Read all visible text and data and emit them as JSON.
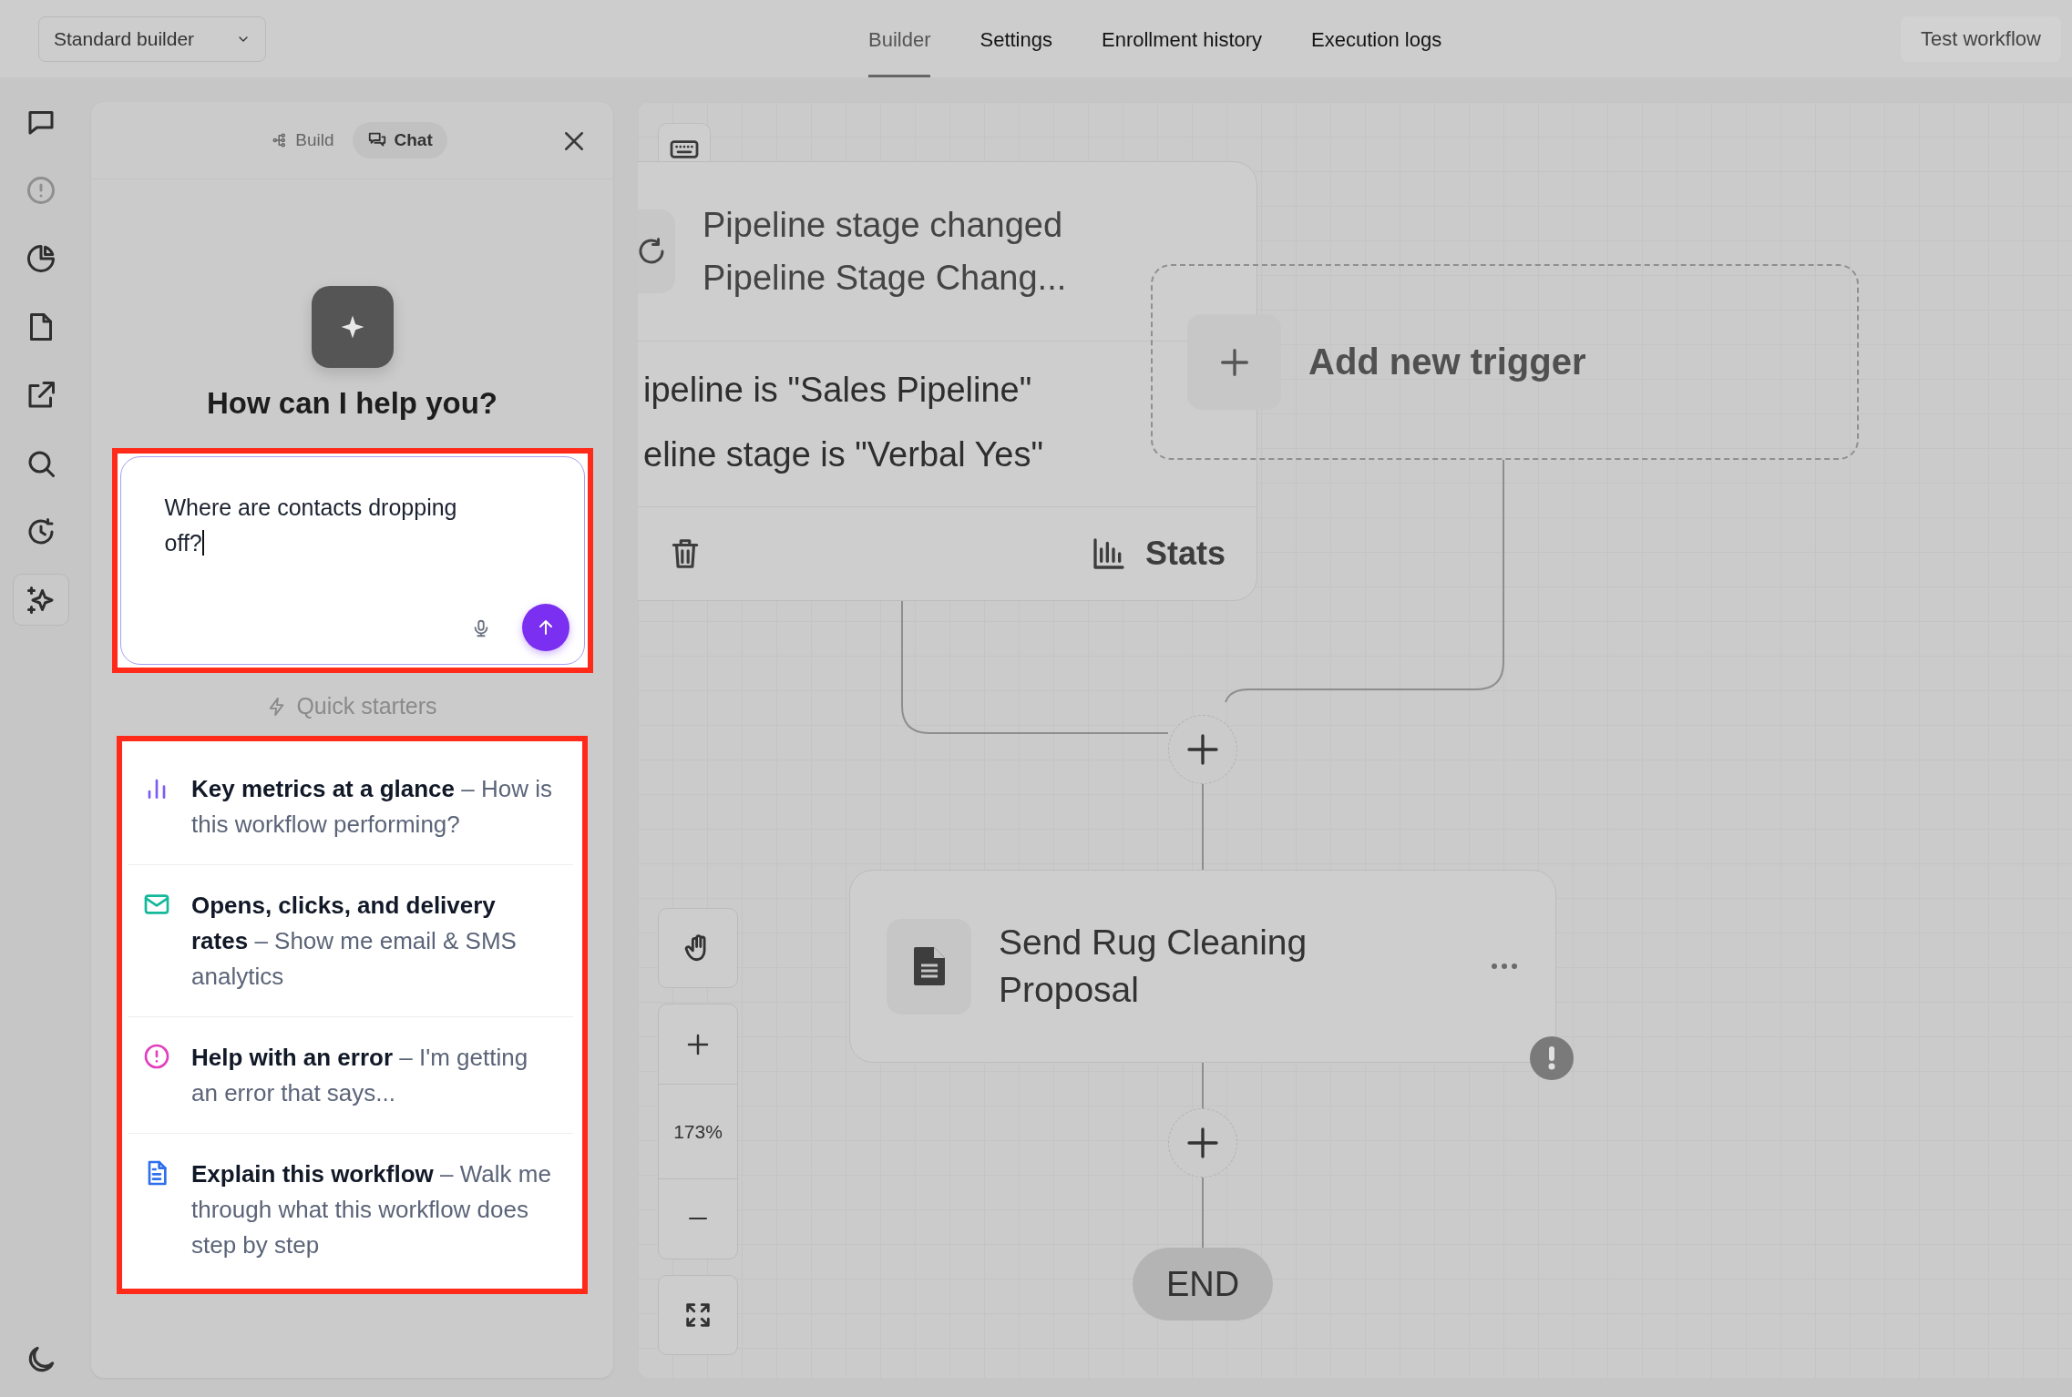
{
  "top_bar": {
    "builder_select": {
      "value": "Standard builder"
    },
    "tabs": [
      {
        "label": "Builder",
        "selected": true
      },
      {
        "label": "Settings",
        "selected": false
      },
      {
        "label": "Enrollment history",
        "selected": false
      },
      {
        "label": "Execution logs",
        "selected": false
      }
    ],
    "test_button": "Test workflow"
  },
  "sidebar": {
    "items": [
      {
        "selected": false,
        "disabled": false
      },
      {
        "selected": false,
        "disabled": true
      },
      {
        "selected": false,
        "disabled": false
      },
      {
        "selected": false,
        "disabled": false
      },
      {
        "selected": false,
        "disabled": false
      },
      {
        "selected": false,
        "disabled": false
      },
      {
        "selected": false,
        "disabled": false
      },
      {
        "selected": true,
        "disabled": false
      }
    ]
  },
  "chat_panel": {
    "mode_tabs": [
      {
        "label": "Build",
        "selected": false
      },
      {
        "label": "Chat",
        "selected": true
      }
    ],
    "heading": "How can I help you?",
    "message_field": {
      "value": "Where are contacts dropping off?",
      "highlighted": true
    },
    "quick_starters": {
      "title": "Quick starters",
      "highlighted": true,
      "items": [
        {
          "text": "**Key metrics at a glance** – How is this workflow performing?",
          "color": "#7c5cf5"
        },
        {
          "text": "**Opens, clicks, and delivery rates** – Show me email & SMS analytics",
          "color": "#14b89a"
        },
        {
          "text": "**Help with an error** – I'm getting an error that says...",
          "color": "#e23fbf"
        },
        {
          "text": "**Explain this workflow** – Walk me through what this workflow does step by step",
          "color": "#2f6fed"
        }
      ]
    }
  },
  "canvas": {
    "trigger_card": {
      "title": "Pipeline stage changed",
      "subtitle": "Pipeline Stage Chang...",
      "conditions": [
        "ipeline is \"Sales Pipeline\"",
        "eline stage is \"Verbal Yes\""
      ],
      "stats_label": "Stats"
    },
    "add_trigger": {
      "label": "Add new trigger"
    },
    "action_card": {
      "title": "Send Rug Cleaning Proposal",
      "warning": true
    },
    "end_label": "END",
    "zoom": {
      "reading": "173%"
    }
  }
}
